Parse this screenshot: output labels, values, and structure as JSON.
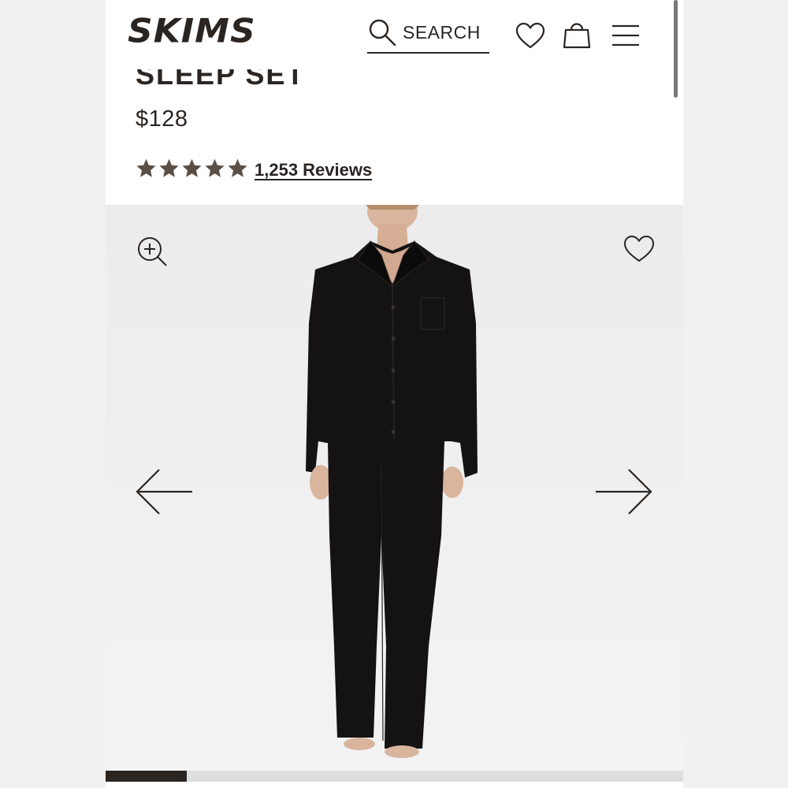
{
  "header": {
    "logo": "SKIMS",
    "search_label": "SEARCH",
    "icons": [
      "search-icon",
      "heart-icon",
      "shopping-bag-icon",
      "menu-icon"
    ]
  },
  "product": {
    "title": "SLEEP SET",
    "price": "$128",
    "rating": 5,
    "rating_max": 5,
    "reviews_label": "1,253 Reviews"
  },
  "gallery": {
    "icons": [
      "zoom-in-icon",
      "heart-icon",
      "arrow-left-icon",
      "arrow-right-icon"
    ],
    "progress_fraction": 0.14
  },
  "colors": {
    "text": "#2b2522",
    "star": "#5a4f46",
    "background": "#f1f1f1",
    "gallery_bg": "#eeeeee",
    "progress_track": "#dedede"
  }
}
